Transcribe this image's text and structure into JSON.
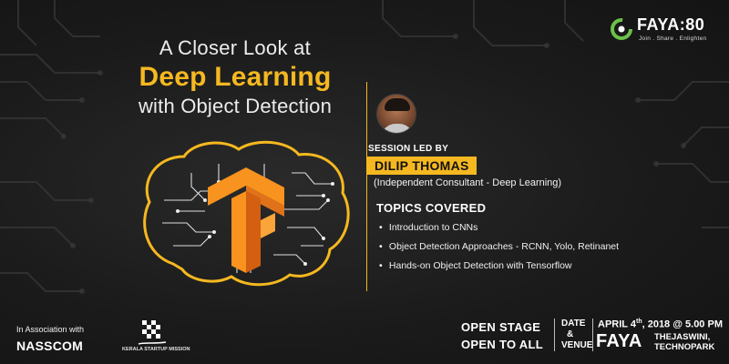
{
  "title": {
    "line1": "A Closer Look at",
    "line2": "Deep Learning",
    "line3": "with Object Detection"
  },
  "logo": {
    "brand": "FAYA:80",
    "tagline": "Join . Share . Enlighten"
  },
  "speaker": {
    "label": "SESSION LED BY",
    "name": "DILIP THOMAS",
    "role": "(Independent Consultant - Deep Learning)"
  },
  "topics": {
    "title": "TOPICS COVERED",
    "items": [
      "Introduction to CNNs",
      "Object Detection Approaches - RCNN, Yolo, Retinanet",
      "Hands-on Object Detection with Tensorflow"
    ]
  },
  "partners": {
    "association_label": "In Association with",
    "nasscom": "NASSCOM",
    "ksum": "KERALA STARTUP MISSION"
  },
  "event": {
    "open_line1": "OPEN STAGE",
    "open_line2": "OPEN TO ALL",
    "date_label_1": "DATE",
    "date_label_2": "&",
    "date_label_3": "VENUE",
    "date_day": "APRIL 4",
    "date_suffix": "th",
    "date_rest": ", 2018 @ 5.00 PM",
    "venue_brand": "FAYA",
    "venue_line1": "THEJASWINI,",
    "venue_line2": "TECHNOPARK"
  },
  "colors": {
    "accent": "#f5b820",
    "background": "#1c1c1c",
    "tensorflow_orange": "#f7931e"
  }
}
